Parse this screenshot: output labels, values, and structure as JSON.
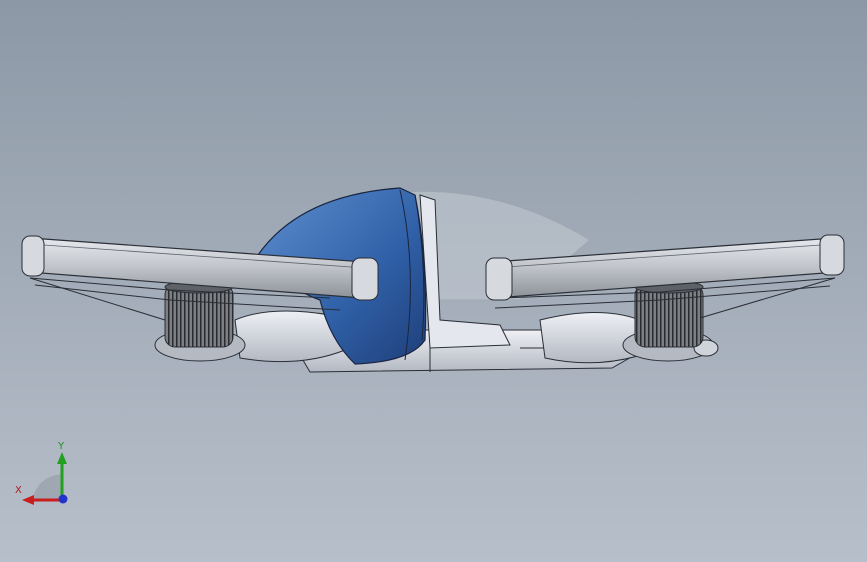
{
  "viewport": {
    "background_top": "#8c98a6",
    "background_bottom": "#b7bfca"
  },
  "model": {
    "body_color": "#3b6db3",
    "frame_color": "#d8dce4",
    "arm_color": "#c9cdd3",
    "motor_color": "#6a6d72",
    "outline_color": "#2a2e36"
  },
  "triad": {
    "x_label": "X",
    "y_label": "Y",
    "x_color": "#c81e1e",
    "y_color": "#22a022",
    "z_color": "#2233cc"
  }
}
